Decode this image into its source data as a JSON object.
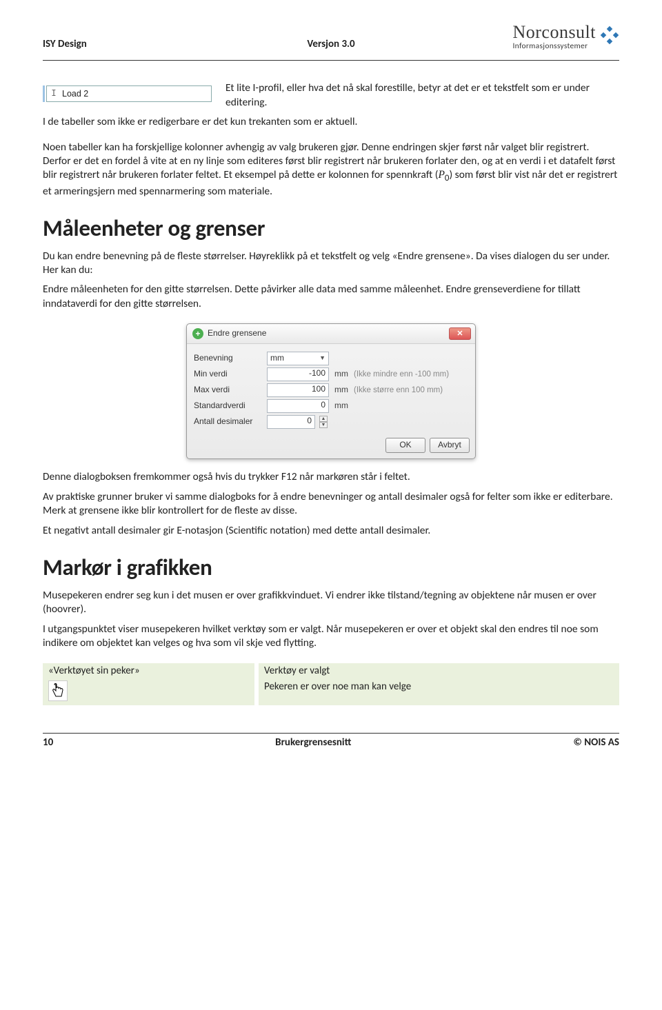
{
  "header": {
    "left": "ISY Design",
    "mid": "Versjon 3.0",
    "logo_main": "Norconsult",
    "logo_sub": "Informasjonssystemer"
  },
  "editing_field": {
    "cursor_glyph": "I",
    "value": "Load 2"
  },
  "body": {
    "p1": "Et lite I-profil, eller hva det nå skal forestille, betyr at det er et tekstfelt som er under editering.",
    "p2": "I de tabeller som ikke er redigerbare er det kun trekanten som er aktuell.",
    "p3a": "Noen tabeller kan ha forskjellige kolonner avhengig av valg brukeren gjør. Denne endringen skjer først når valget blir registrert. Derfor er det en fordel å vite at en ny linje som editeres først blir registrert når brukeren forlater den, og at en verdi i et datafelt først blir registrert når brukeren forlater feltet. Et eksempel på dette er kolonnen for spennkraft (",
    "p3_symbol": "P",
    "p3_sub": "0",
    "p3b": ") som først blir vist når det er registrert et armeringsjern med spennarmering som materiale.",
    "h1a": "Måleenheter og grenser",
    "p4": "Du kan endre benevning på de fleste størrelser. Høyreklikk på et tekstfelt og velg «Endre grensene». Da vises dialogen du ser under. Her kan du:",
    "p5": "Endre måleenheten for den gitte størrelsen. Dette påvirker alle data med samme måleenhet. Endre grenseverdiene for tillatt inndataverdi for den gitte størrelsen.",
    "p6": "Denne dialogboksen fremkommer også hvis du trykker F12 når markøren står i feltet.",
    "p7": "Av praktiske grunner bruker vi samme dialogboks for å endre benevninger og antall desimaler også for felter som ikke er editerbare. Merk at grensene ikke blir kontrollert for de fleste av disse.",
    "p8": "Et negativt antall desimaler gir E-notasjon (Scientific notation) med dette antall desimaler.",
    "h1b": "Markør i grafikken",
    "p9": "Musepekeren endrer seg kun i det musen er over grafikkvinduet. Vi endrer ikke tilstand/tegning av objektene når musen er over (hoovrer).",
    "p10": "I utgangspunktet viser musepekeren hvilket verktøy som er valgt. Når musepekeren er over et objekt skal den endres til noe som indikere om objektet kan velges og hva som vil skje ved flytting."
  },
  "dialog": {
    "title": "Endre grensene",
    "rows": {
      "benevning_label": "Benevning",
      "benevning_value": "mm",
      "min_label": "Min verdi",
      "min_value": "-100",
      "min_unit": "mm",
      "min_hint": "(Ikke mindre enn -100 mm)",
      "max_label": "Max verdi",
      "max_value": "100",
      "max_unit": "mm",
      "max_hint": "(Ikke større enn 100 mm)",
      "std_label": "Standardverdi",
      "std_value": "0",
      "std_unit": "mm",
      "dec_label": "Antall desimaler",
      "dec_value": "0"
    },
    "ok": "OK",
    "cancel": "Avbryt"
  },
  "tool_table": {
    "r1c1": "«Verktøyet sin peker»",
    "r1c2": "Verktøy er valgt",
    "r2c2": "Pekeren er over noe man kan velge"
  },
  "footer": {
    "left": "10",
    "mid": "Brukergrensesnitt",
    "right": "© NOIS AS"
  }
}
